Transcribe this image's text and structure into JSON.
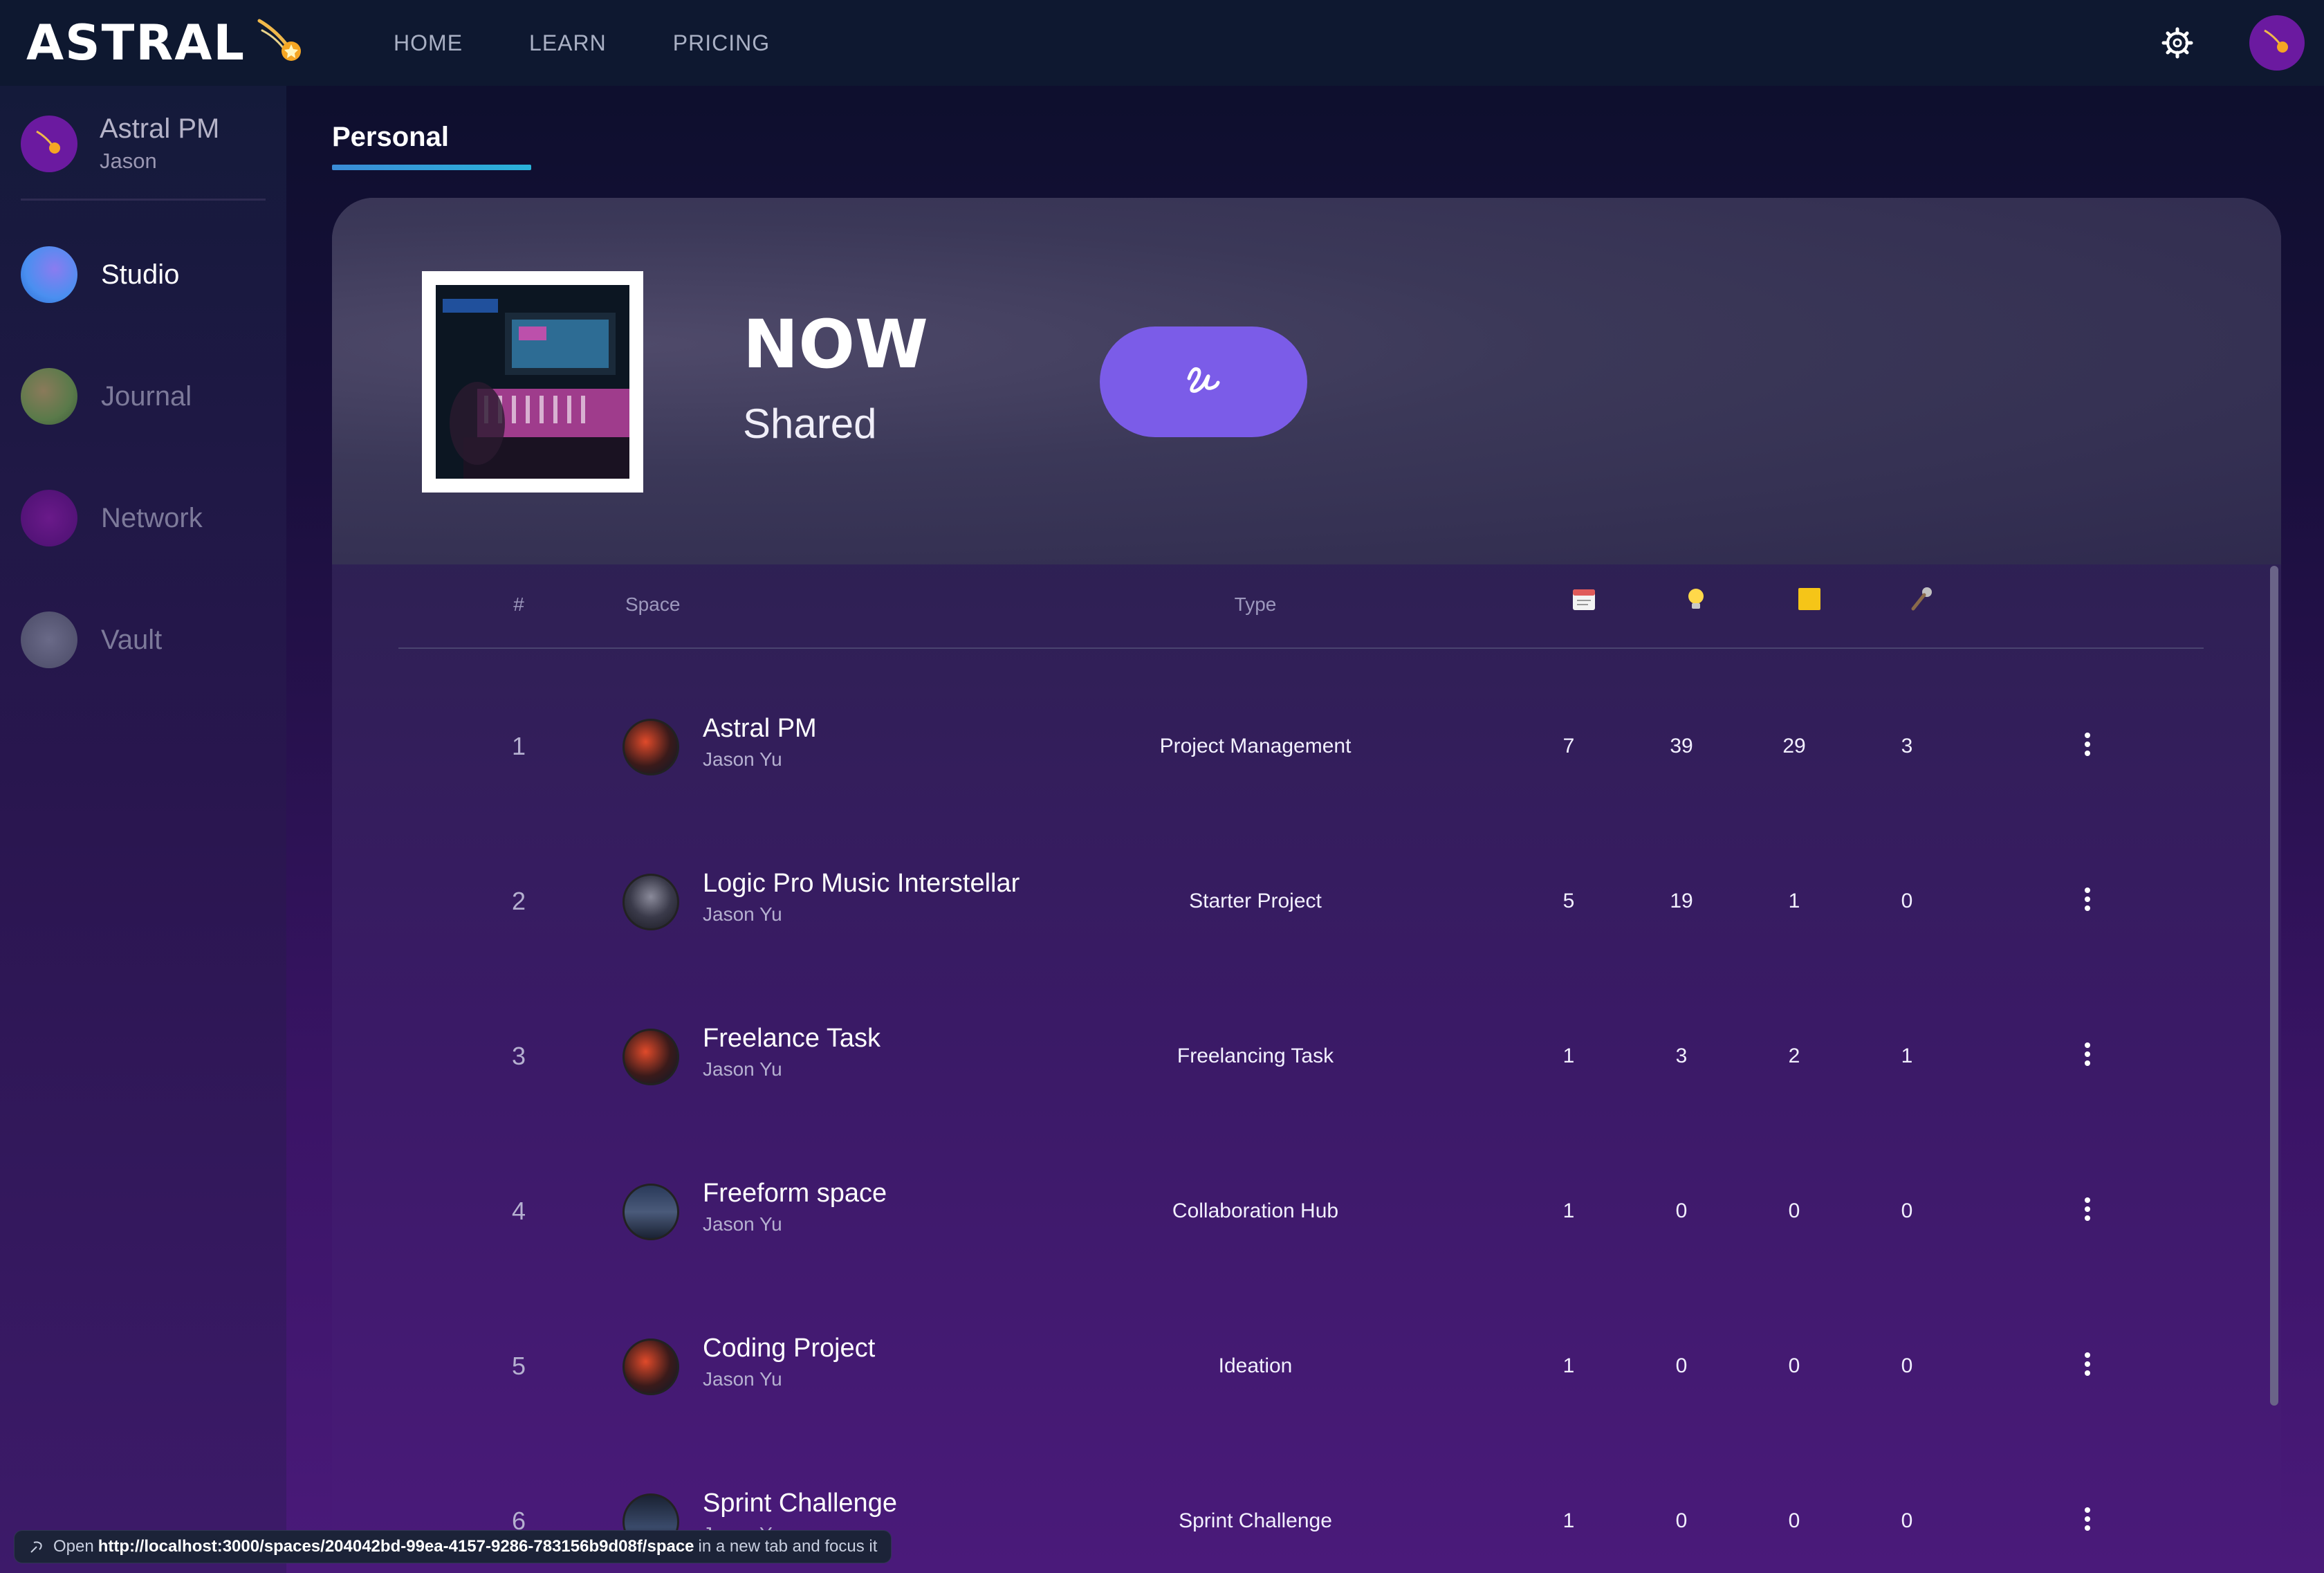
{
  "brand": {
    "name": "ASTRAL"
  },
  "nav": {
    "items": [
      "HOME",
      "LEARN",
      "PRICING"
    ]
  },
  "profile": {
    "name": "Astral PM",
    "user": "Jason"
  },
  "sidebar": {
    "items": [
      {
        "label": "Studio",
        "active": true,
        "color": "#4a8ff0"
      },
      {
        "label": "Journal",
        "active": false,
        "color": "#6a8a50"
      },
      {
        "label": "Network",
        "active": false,
        "color": "#5a1a80"
      },
      {
        "label": "Vault",
        "active": false,
        "color": "#5a5a78"
      }
    ]
  },
  "tabs": {
    "active": "Personal"
  },
  "hero": {
    "title": "NOW",
    "subtitle": "Shared",
    "accent": "#7b5ce8"
  },
  "table": {
    "headers": {
      "num": "#",
      "space": "Space",
      "type": "Type"
    },
    "icon_headers": [
      "calendar-icon",
      "lightbulb-icon",
      "sticky-note-icon",
      "microphone-icon"
    ],
    "rows": [
      {
        "num": "1",
        "name": "Astral PM",
        "owner": "Jason Yu",
        "type": "Project Management",
        "values": [
          "7",
          "39",
          "29",
          "3"
        ]
      },
      {
        "num": "2",
        "name": "Logic Pro Music Interstellar",
        "owner": "Jason Yu",
        "type": "Starter Project",
        "values": [
          "5",
          "19",
          "1",
          "0"
        ]
      },
      {
        "num": "3",
        "name": "Freelance Task",
        "owner": "Jason Yu",
        "type": "Freelancing Task",
        "values": [
          "1",
          "3",
          "2",
          "1"
        ]
      },
      {
        "num": "4",
        "name": "Freeform space",
        "owner": "Jason Yu",
        "type": "Collaboration Hub",
        "values": [
          "1",
          "0",
          "0",
          "0"
        ]
      },
      {
        "num": "5",
        "name": "Coding Project",
        "owner": "Jason Yu",
        "type": "Ideation",
        "values": [
          "1",
          "0",
          "0",
          "0"
        ]
      },
      {
        "num": "6",
        "name": "Sprint Challenge",
        "owner": "Jason Yu",
        "type": "Sprint Challenge",
        "values": [
          "1",
          "0",
          "0",
          "0"
        ]
      }
    ]
  },
  "status": {
    "prefix": "Open",
    "url": "http://localhost:3000/spaces/204042bd-99ea-4157-9286-783156b9d08f/space",
    "suffix": "in a new tab and focus it"
  }
}
